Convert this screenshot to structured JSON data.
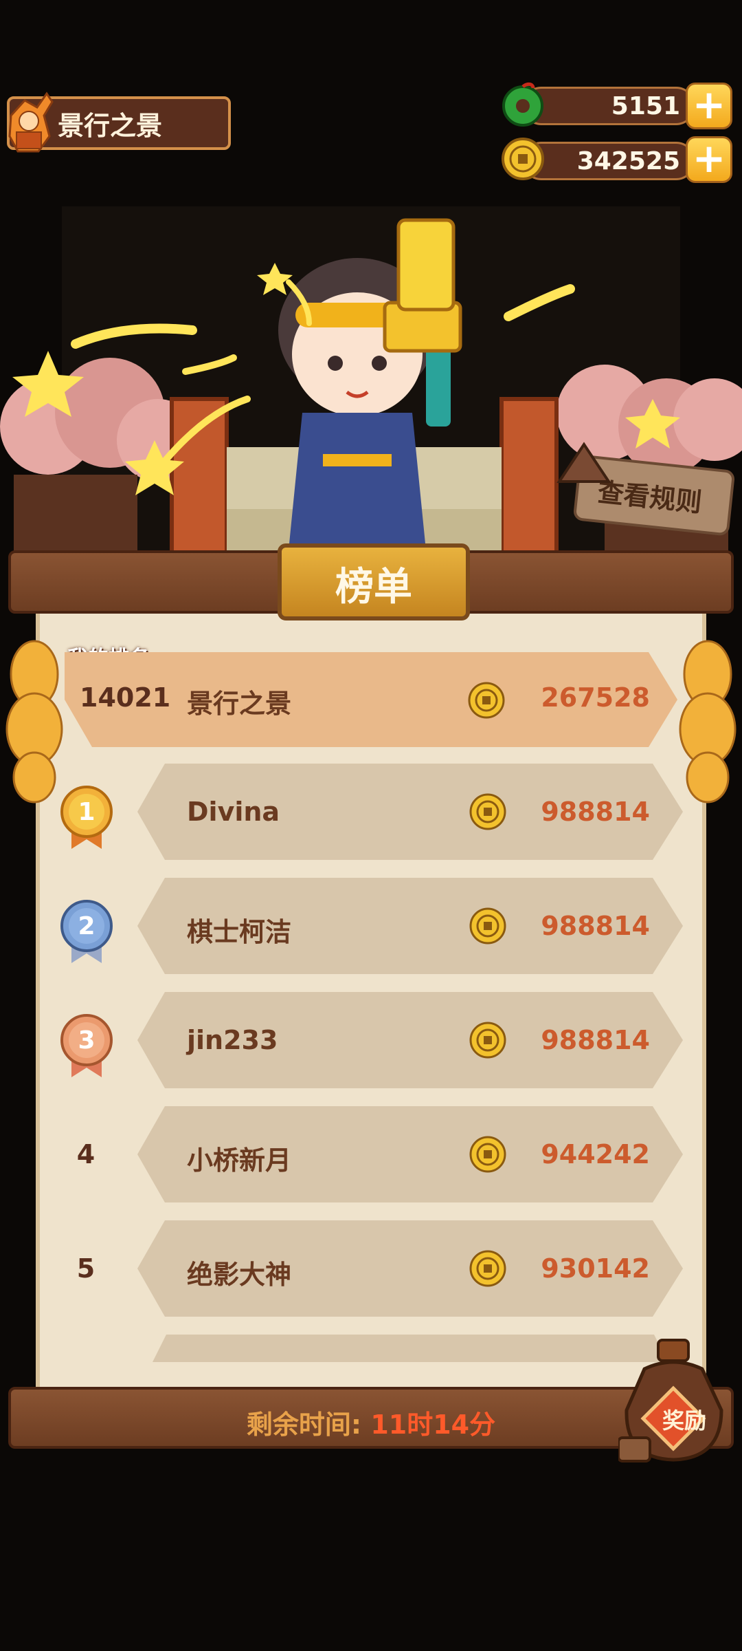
{
  "header": {
    "player_name": "景行之景",
    "jade_value": "5151",
    "coin_value": "342525",
    "plus_label": "+"
  },
  "rules_button": {
    "label": "查看规则"
  },
  "board": {
    "title": "榜单",
    "my_rank_label": "我的排名",
    "my_row": {
      "rank": "14021",
      "name": "景行之景",
      "score": "267528"
    },
    "rows": [
      {
        "rank": "1",
        "name": "Divina",
        "score": "988814"
      },
      {
        "rank": "2",
        "name": "棋士柯洁",
        "score": "988814"
      },
      {
        "rank": "3",
        "name": "jin233",
        "score": "988814"
      },
      {
        "rank": "4",
        "name": "小桥新月",
        "score": "944242"
      },
      {
        "rank": "5",
        "name": "绝影大神",
        "score": "930142"
      }
    ]
  },
  "footer": {
    "remaining_label": "剩余时间: ",
    "remaining_value": "11时14分"
  },
  "reward": {
    "label": "奖励"
  },
  "colors": {
    "wood_dark": "#4a2412",
    "wood": "#8a5433",
    "parchment": "#efe3cc",
    "score": "#cc5b2d",
    "timer_value": "#ff5a2a",
    "timer_label": "#e8a24a",
    "gold": "#f3c22d"
  }
}
